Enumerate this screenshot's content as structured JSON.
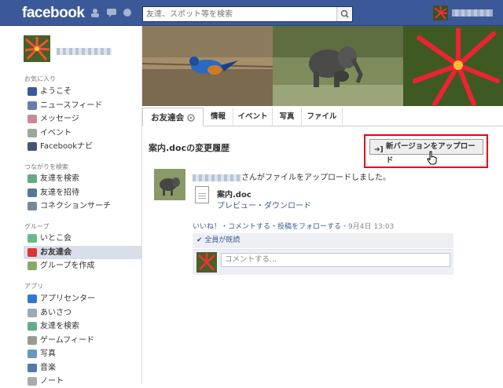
{
  "header": {
    "logo": "facebook",
    "search_placeholder": "友達、スポット等を検索"
  },
  "sidebar": {
    "favorites_label": "お気に入り",
    "favorites": [
      {
        "label": "ようこそ",
        "icon": "welcome-icon",
        "color": "#3b5998"
      },
      {
        "label": "ニュースフィード",
        "icon": "news-feed-icon",
        "color": "#6a7bb0"
      },
      {
        "label": "メッセージ",
        "icon": "messages-icon",
        "color": "#c89"
      },
      {
        "label": "イベント",
        "icon": "events-icon",
        "color": "#9a9"
      },
      {
        "label": "Facebookナビ",
        "icon": "navi-icon",
        "color": "#457"
      }
    ],
    "connect_label": "つながりを検索",
    "connect": [
      {
        "label": "友達を検索",
        "icon": "find-friends-icon",
        "color": "#6a8"
      },
      {
        "label": "友達を招待",
        "icon": "invite-icon",
        "color": "#579"
      },
      {
        "label": "コネクションサーチ",
        "icon": "magnifier-icon",
        "color": "#789"
      }
    ],
    "groups_label": "グループ",
    "groups": [
      {
        "label": "いとこ会",
        "icon": "group-icon",
        "color": "#6b8"
      },
      {
        "label": "お友達会",
        "icon": "apple-icon",
        "color": "#d33"
      },
      {
        "label": "グループを作成",
        "icon": "create-group-icon",
        "color": "#8a6"
      }
    ],
    "apps_label": "アプリ",
    "apps": [
      {
        "label": "アプリセンター",
        "icon": "app-center-icon",
        "color": "#37c"
      },
      {
        "label": "あいさつ",
        "icon": "poke-icon",
        "color": "#9ab"
      },
      {
        "label": "友達を検索",
        "icon": "find-friends-icon",
        "color": "#6a8"
      },
      {
        "label": "ゲームフィード",
        "icon": "games-icon",
        "color": "#999"
      },
      {
        "label": "写真",
        "icon": "photos-icon",
        "color": "#69b"
      },
      {
        "label": "音楽",
        "icon": "music-icon",
        "color": "#57a"
      },
      {
        "label": "ノート",
        "icon": "notes-icon",
        "color": "#aaa"
      }
    ]
  },
  "tabs": [
    {
      "label": "お友達会"
    },
    {
      "label": "情報"
    },
    {
      "label": "イベント"
    },
    {
      "label": "写真"
    },
    {
      "label": "ファイル"
    }
  ],
  "main": {
    "doc_history_title": "案内.docの変更履歴",
    "upload_button": "新バージョンをアップロード",
    "post_text": "さんがファイルをアップロードしました。",
    "file_name": "案内.doc",
    "file_links": "プレビュー・ダウンロード",
    "actions": "いいね！・コメントする・投稿をフォローする",
    "timestamp": "・9月4日 13:03",
    "seen_by": "全員が既読",
    "comment_placeholder": "コメントする..."
  }
}
